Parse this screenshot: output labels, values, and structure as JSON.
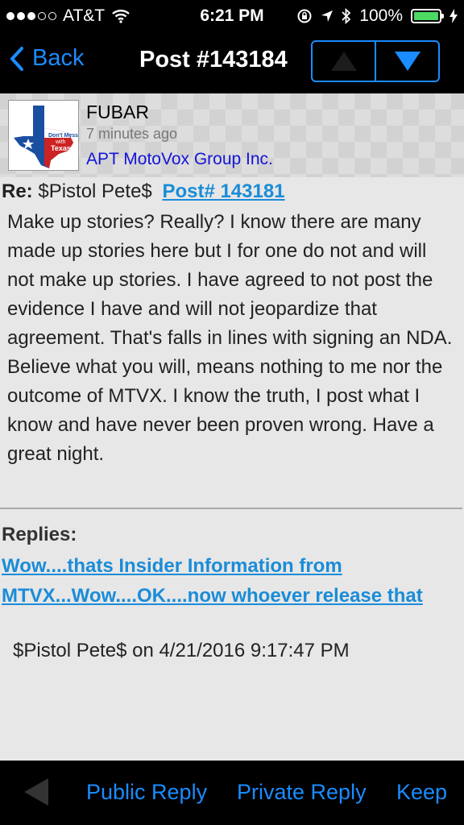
{
  "status_bar": {
    "carrier": "AT&T",
    "time": "6:21 PM",
    "battery_percent": "100%",
    "battery_level": 1.0,
    "signal_bars": 3,
    "signal_total": 5,
    "icons": [
      "wifi-icon",
      "rotation-lock-icon",
      "location-icon",
      "bluetooth-icon",
      "battery-icon",
      "charging-icon"
    ]
  },
  "nav": {
    "back_label": "Back",
    "title": "Post #143184",
    "upvote_icon": "arrow-up-icon",
    "downvote_icon": "arrow-down-icon"
  },
  "author": {
    "avatar_text_line1": "Don't Mess",
    "avatar_text_line2": "with",
    "avatar_text_line3": "Texas",
    "name": "FUBAR",
    "age": "7 minutes ago",
    "company": "APT MotoVox Group Inc."
  },
  "post": {
    "re_label": "Re:",
    "re_author": "$Pistol Pete$",
    "parent_link": "Post# 143181",
    "message": "Make up stories? Really? I know there are many made up stories here but I for one do not and will not make up stories. I have agreed to not post the evidence I have and will not jeopardize that agreement. That's falls in lines with signing an NDA. Believe what you will, means nothing to me nor the outcome of MTVX. I know the truth, I post what I know and have never been proven wrong. Have a great night."
  },
  "replies": {
    "label": "Replies:",
    "items": [
      {
        "title": "Wow....thats Insider Information from MTVX...Wow....OK....now whoever release that",
        "meta": "$Pistol Pete$ on 4/21/2016 9:17:47 PM"
      }
    ]
  },
  "toolbar": {
    "public_reply": "Public Reply",
    "private_reply": "Private Reply",
    "keep": "Keep"
  },
  "colors": {
    "accent": "#1a8cff",
    "link": "#1a8cd8",
    "company_link": "#1414d8",
    "battery": "#4cd964"
  }
}
